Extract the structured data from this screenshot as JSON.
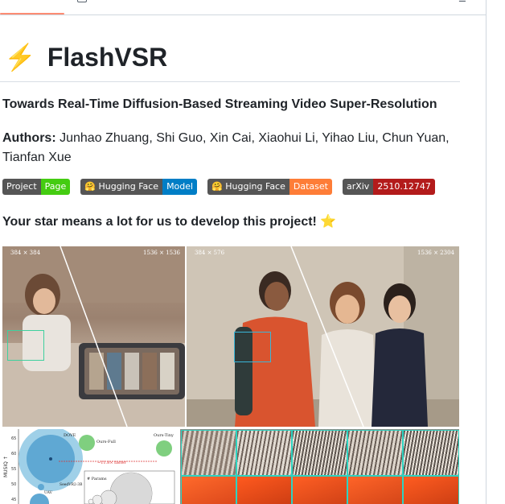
{
  "header": {
    "tab_underline_color": "#fd8c73"
  },
  "title": {
    "icon": "lightning-bolt-icon",
    "text": "FlashVSR"
  },
  "tagline": "Towards Real-Time Diffusion-Based Streaming Video Super-Resolution",
  "authors": {
    "label": "Authors:",
    "names": "Junhao Zhuang, Shi Guo, Xin Cai, Xiaohui Li, Yihao Liu, Chun Yuan, Tianfan Xue"
  },
  "badges": [
    {
      "left": "Project",
      "right": "Page",
      "color": "#4c1"
    },
    {
      "left": "🤗 Hugging Face",
      "right": "Model",
      "color": "#007ec6"
    },
    {
      "left": "🤗 Hugging Face",
      "right": "Dataset",
      "color": "#fe7d37"
    },
    {
      "left": "arXiv",
      "right": "2510.12747",
      "color": "#b31b1b"
    }
  ],
  "star_line": {
    "text": "Your star means a lot for us to develop this project!",
    "emoji": "⭐"
  },
  "figure": {
    "panel1": {
      "label_left": "384 × 384",
      "label_right": "1536 × 1536"
    },
    "panel2": {
      "label_left": "384 × 576",
      "label_right": "1536 × 2304"
    },
    "chart": {
      "ylabel": "MUSIQ ↑",
      "yticks": [
        "65",
        "60",
        "55",
        "50",
        "45"
      ],
      "labels": [
        "DOVE",
        "Ours-Full",
        "Ours-Tiny",
        "~11.8× faster",
        "SeedVR2-3B",
        "# Params",
        "UAV"
      ]
    }
  }
}
